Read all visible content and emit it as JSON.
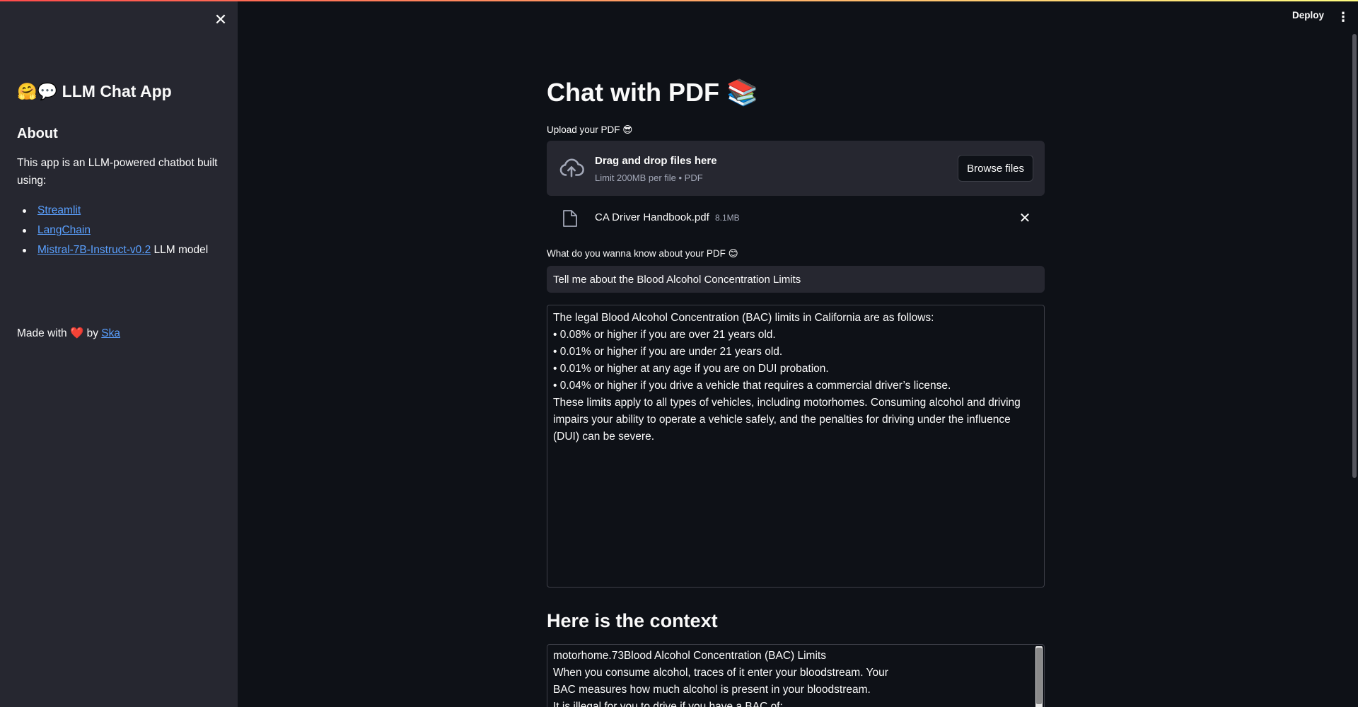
{
  "sidebar": {
    "title": "🤗💬 LLM Chat App",
    "about_heading": "About",
    "about_text": "This app is an LLM-powered chatbot built using:",
    "links": [
      {
        "label": "Streamlit",
        "suffix": ""
      },
      {
        "label": "LangChain",
        "suffix": ""
      },
      {
        "label": "Mistral-7B-Instruct-v0.2",
        "suffix": " LLM model"
      }
    ],
    "made_with_prefix": "Made with",
    "made_with_heart": "❤️",
    "made_with_by": "by",
    "made_with_author": "Ska"
  },
  "header": {
    "deploy_label": "Deploy",
    "menu_glyph": "⋮"
  },
  "main": {
    "title": "Chat with PDF 📚",
    "upload_label": "Upload your PDF 😎",
    "dropzone": {
      "title": "Drag and drop files here",
      "limit": "Limit 200MB per file • PDF",
      "browse_label": "Browse files"
    },
    "uploaded_file": {
      "name": "CA Driver Handbook.pdf",
      "size": "8.1MB"
    },
    "question_label": "What do you wanna know about your PDF 😊",
    "question_value": "Tell me about the Blood Alcohol Concentration Limits",
    "answer_lines": [
      "The legal Blood Alcohol Concentration (BAC) limits in California are as follows:",
      "• 0.08% or higher if you are over 21 years old.",
      "• 0.01% or higher if you are under 21 years old.",
      "• 0.01% or higher at any age if you are on DUI probation.",
      "• 0.04% or higher if you drive a vehicle that requires a commercial driver’s license.",
      "These limits apply to all types of vehicles, including motorhomes. Consuming alcohol and driving impairs your ability to operate a vehicle safely, and the penalties for driving under the influence (DUI) can be severe."
    ],
    "context_heading": "Here is the context",
    "context_lines": [
      "motorhome.73Blood Alcohol Concentration (BAC) Limits",
      "When you consume alcohol, traces of it enter your bloodstream. Your",
      "BAC measures how much alcohol is present in your bloodstream.",
      "It is illegal for you to drive if you have a BAC of:"
    ]
  },
  "colors": {
    "background": "#0e1117",
    "sidebar": "#262730",
    "link": "#5aa0ff",
    "heart": "#ff2b2b",
    "accent_gradient_start": "#ff4b4b",
    "accent_gradient_end": "#fffd80"
  },
  "icons": {
    "close": "close-icon",
    "upload": "cloud-upload-icon",
    "file": "file-icon",
    "remove": "close-icon",
    "menu": "vertical-dots-icon"
  }
}
